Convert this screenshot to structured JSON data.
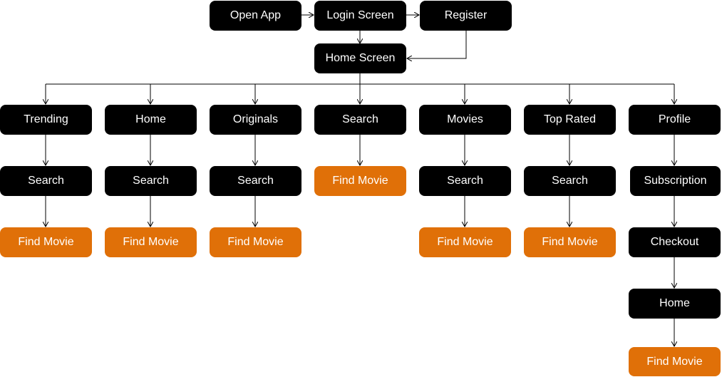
{
  "nodes": {
    "open_app": "Open App",
    "login": "Login Screen",
    "register": "Register",
    "home_screen": "Home Screen",
    "trending": "Trending",
    "home": "Home",
    "originals": "Originals",
    "search": "Search",
    "movies": "Movies",
    "top_rated": "Top Rated",
    "profile": "Profile",
    "trending_search": "Search",
    "home_search": "Search",
    "originals_search": "Search",
    "search_find": "Find Movie",
    "movies_search": "Search",
    "top_rated_search": "Search",
    "subscription": "Subscription",
    "trending_find": "Find Movie",
    "home_find": "Find Movie",
    "originals_find": "Find Movie",
    "movies_find": "Find Movie",
    "top_rated_find": "Find Movie",
    "checkout": "Checkout",
    "profile_home": "Home",
    "profile_find": "Find Movie"
  },
  "colors": {
    "node_dark": "#000000",
    "node_accent": "#e07008",
    "node_text": "#ffffff",
    "connector": "#000000"
  }
}
